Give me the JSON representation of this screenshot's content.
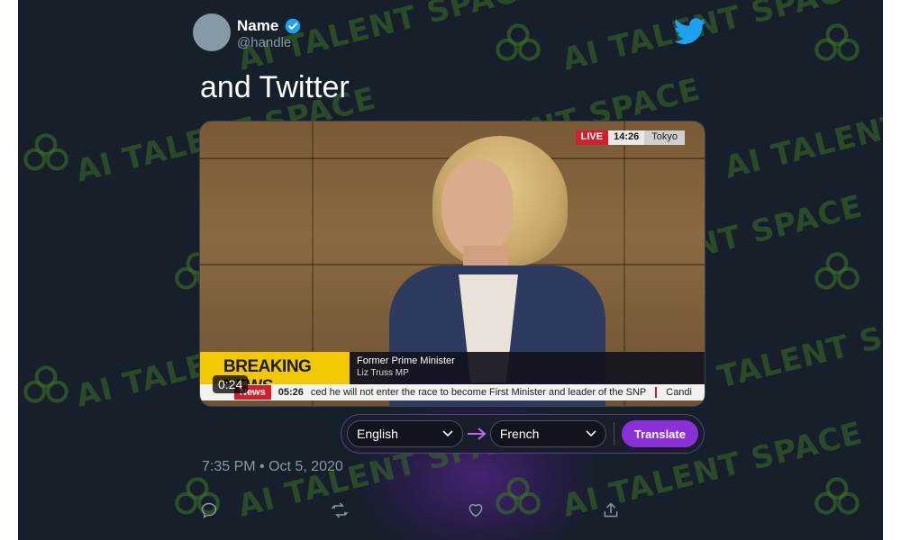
{
  "author": {
    "name": "Name",
    "handle": "@handle",
    "verified": true
  },
  "tweet": {
    "text": "and Twitter",
    "timestamp": "7:35 PM • Oct 5, 2020"
  },
  "video": {
    "duration": "0:24",
    "live_label": "LIVE",
    "clock": "14:26",
    "city": "Tokyo",
    "breaking_label": "BREAKING NEWS",
    "caption_line1": "Former Prime Minister",
    "caption_line2": "Liz Truss MP",
    "ticker_tag": "News",
    "ticker_time": "05:26",
    "ticker_text": "ced he will not enter the race to become First Minister and leader of the SNP",
    "ticker_next": "Candi"
  },
  "translate": {
    "source_language": "English",
    "target_language": "French",
    "button_label": "Translate"
  },
  "watermark": {
    "text": "AI TALENT SPACE",
    "color": "#3c6e28"
  },
  "actions": [
    "reply-icon",
    "retweet-icon",
    "like-icon",
    "share-icon"
  ],
  "colors": {
    "background": "#15202b",
    "accent": "#8b2fd8",
    "verified": "#1da1f2",
    "muted": "#8899a6"
  }
}
